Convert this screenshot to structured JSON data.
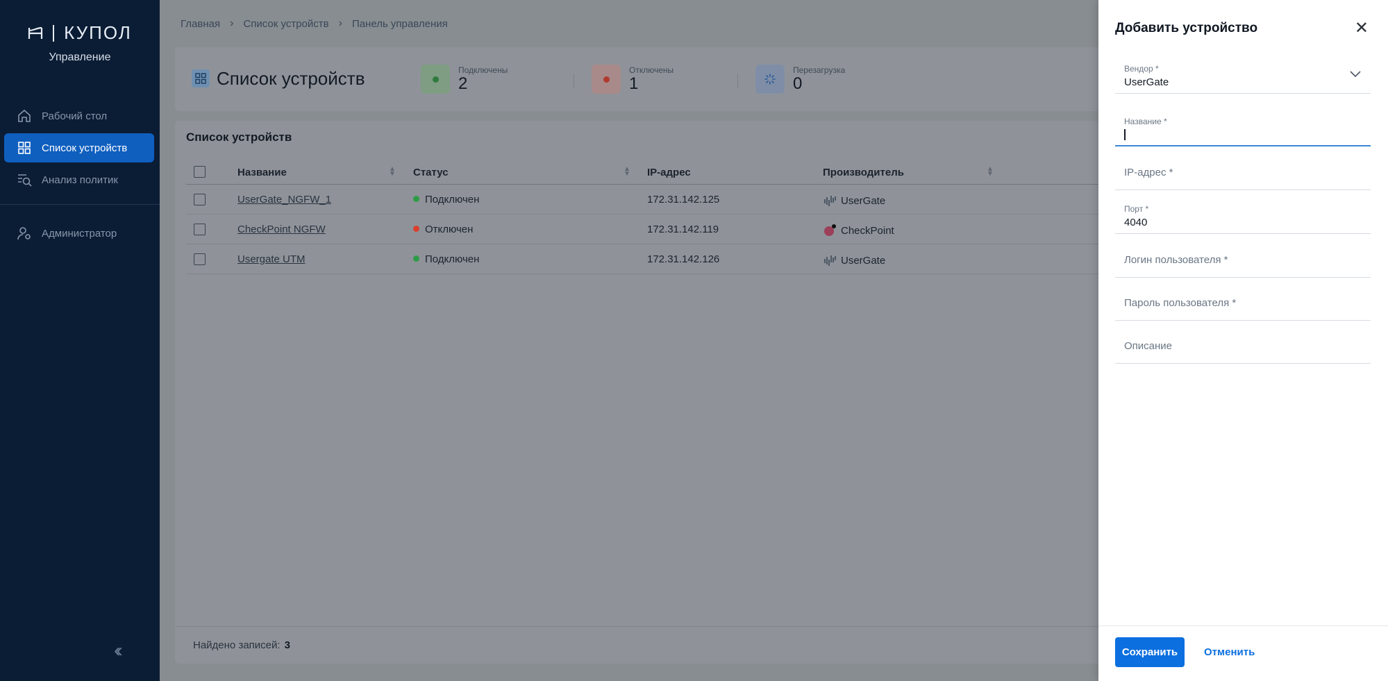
{
  "app": {
    "logo_text": "КУПОЛ",
    "logo_subtitle": "Управление"
  },
  "sidebar": {
    "items": [
      {
        "label": "Рабочий стол",
        "icon": "home-icon",
        "active": false
      },
      {
        "label": "Список устройств",
        "icon": "grid-icon",
        "active": true
      },
      {
        "label": "Анализ политик",
        "icon": "search-list-icon",
        "active": false
      },
      {
        "label": "Администратор",
        "icon": "user-gear-icon",
        "active": false
      }
    ],
    "collapse_icon": "double-chevron-left-icon"
  },
  "breadcrumb": [
    "Главная",
    "Список устройств",
    "Панель управления"
  ],
  "page": {
    "title": "Список устройств",
    "stats": [
      {
        "label": "Подключены",
        "value": "2",
        "color": "#4caf50"
      },
      {
        "label": "Отключены",
        "value": "1",
        "color": "#e53935"
      },
      {
        "label": "Перезагрузка",
        "value": "0",
        "color": "#1e88e5"
      }
    ]
  },
  "table": {
    "title": "Список устройств",
    "columns": [
      "Название",
      "Статус",
      "IP-адрес",
      "Производитель"
    ],
    "rows": [
      {
        "name": "UserGate_NGFW_1",
        "status": "Подключен",
        "status_color": "#2e9c47",
        "ip": "172.31.142.125",
        "vendor": "UserGate",
        "vendor_icon": "usergate-logo-icon"
      },
      {
        "name": "CheckPoint NGFW",
        "status": "Отключен",
        "status_color": "#d9402e",
        "ip": "172.31.142.119",
        "vendor": "CheckPoint",
        "vendor_icon": "checkpoint-logo-icon"
      },
      {
        "name": "Usergate UTM",
        "status": "Подключен",
        "status_color": "#2e9c47",
        "ip": "172.31.142.126",
        "vendor": "UserGate",
        "vendor_icon": "usergate-logo-icon"
      }
    ],
    "found_label": "Найдено записей:",
    "found_count": "3"
  },
  "drawer": {
    "title": "Добавить устройство",
    "close_icon": "close-icon",
    "fields": {
      "vendor": {
        "label": "Вендор *",
        "value": "UserGate"
      },
      "name": {
        "label": "Название *",
        "value": ""
      },
      "ip": {
        "placeholder": "IP-адрес *"
      },
      "port": {
        "label": "Порт *",
        "value": "4040"
      },
      "login": {
        "placeholder": "Логин пользователя *"
      },
      "password": {
        "placeholder": "Пароль пользователя *"
      },
      "description": {
        "placeholder": "Описание"
      }
    },
    "save_label": "Сохранить",
    "cancel_label": "Отменить"
  }
}
